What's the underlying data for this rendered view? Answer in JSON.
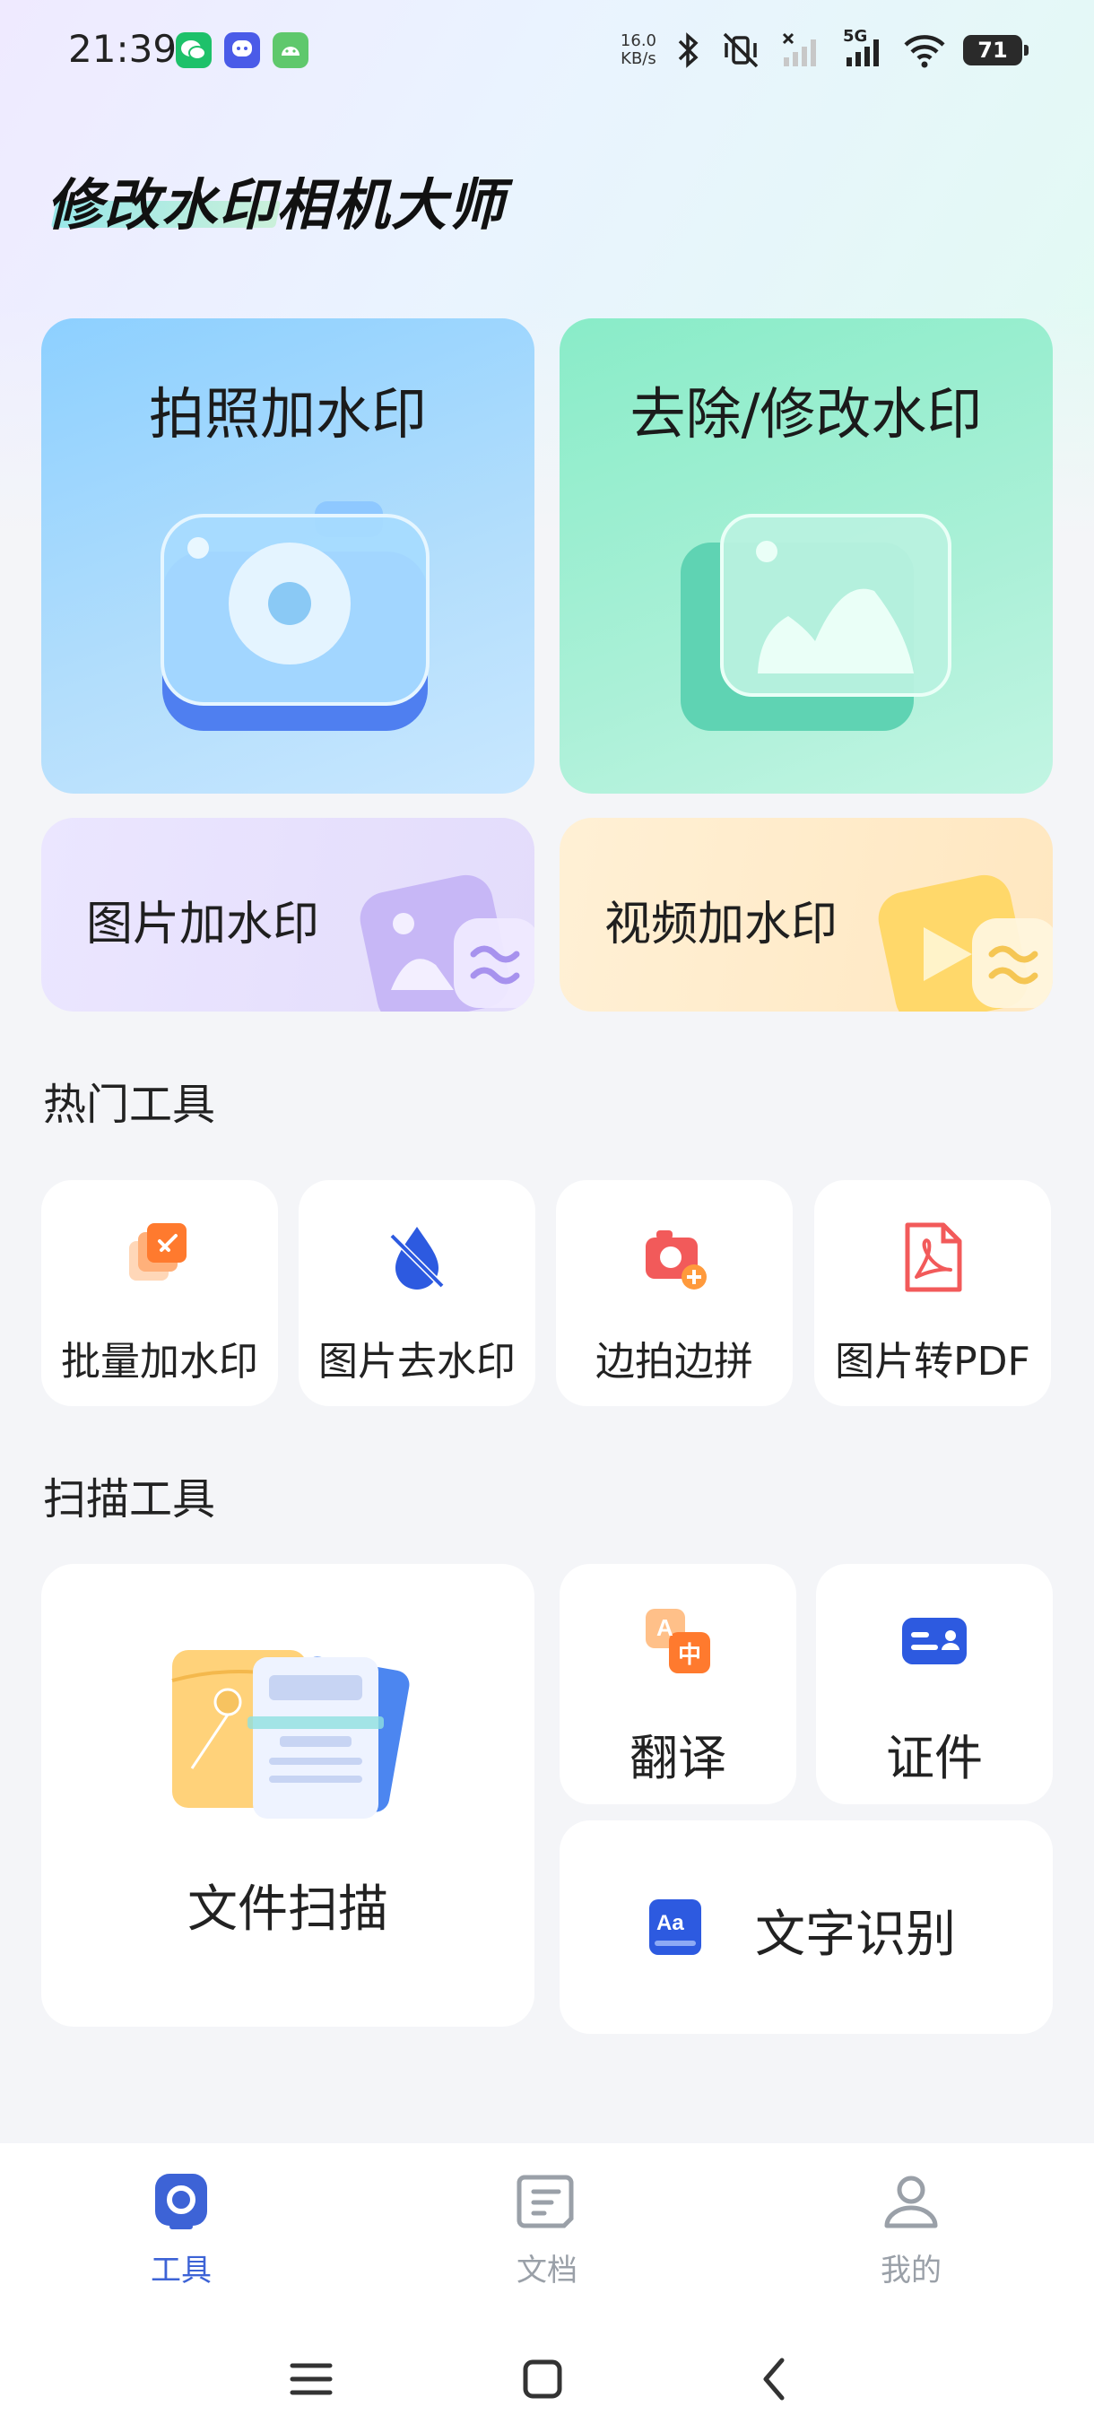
{
  "status_bar": {
    "time": "21:39",
    "net_speed_value": "16.0",
    "net_speed_unit": "KB/s",
    "network": "5G",
    "battery": "71"
  },
  "app": {
    "title": "修改水印相机大师"
  },
  "feature_cards": {
    "take_photo": "拍照加水印",
    "remove_edit": "去除/修改水印",
    "image_watermark": "图片加水印",
    "video_watermark": "视频加水印"
  },
  "hot_tools": {
    "title": "热门工具",
    "items": [
      {
        "label": "批量加水印",
        "icon": "batch-watermark-icon"
      },
      {
        "label": "图片去水印",
        "icon": "water-drop-slash-icon"
      },
      {
        "label": "边拍边拼",
        "icon": "camera-plus-icon"
      },
      {
        "label": "图片转PDF",
        "icon": "pdf-icon"
      }
    ]
  },
  "scan_tools": {
    "title": "扫描工具",
    "doc_scan": "文件扫描",
    "translate": "翻译",
    "id_card": "证件",
    "ocr": "文字识别",
    "translate_icon_text_a": "A",
    "translate_icon_text_b": "中",
    "ocr_icon_text": "Aa"
  },
  "bottom_nav": {
    "items": [
      {
        "label": "工具",
        "active": true
      },
      {
        "label": "文档",
        "active": false
      },
      {
        "label": "我的",
        "active": false
      }
    ]
  },
  "colors": {
    "accent": "#3d63d6",
    "inactive": "#9aa0a8"
  }
}
